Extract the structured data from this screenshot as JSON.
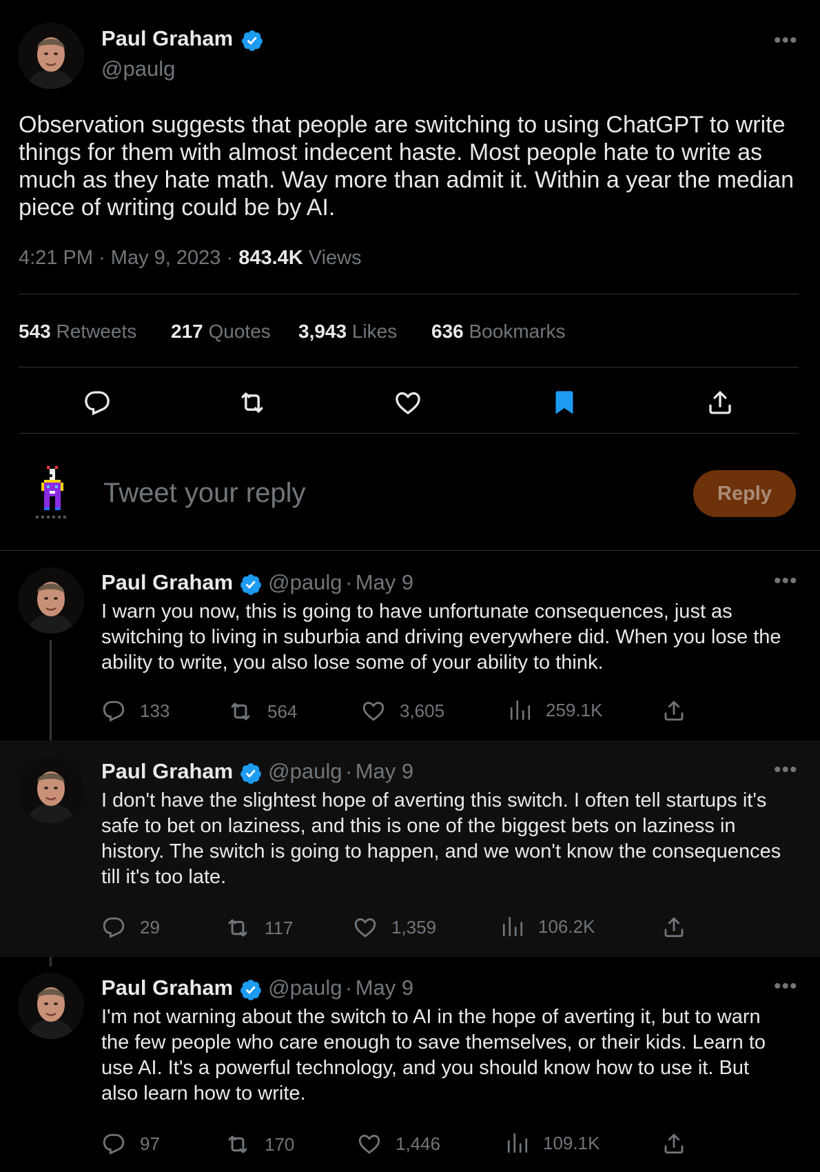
{
  "main_tweet": {
    "author_name": "Paul Graham",
    "author_handle": "@paulg",
    "text": "Observation suggests that people are switching to using ChatGPT to write things for them with almost indecent haste. Most people hate to write as much as they hate math. Way more than admit it. Within a year the median piece of writing could be by AI.",
    "time": "4:21 PM",
    "date": "May 9, 2023",
    "views_count": "843.4K",
    "views_label": "Views",
    "stats": [
      {
        "count": "543",
        "label": "Retweets"
      },
      {
        "count": "217",
        "label": "Quotes"
      },
      {
        "count": "3,943",
        "label": "Likes"
      },
      {
        "count": "636",
        "label": "Bookmarks"
      }
    ],
    "bookmarked": true
  },
  "reply_box": {
    "placeholder": "Tweet your reply",
    "button_label": "Reply"
  },
  "thread": [
    {
      "author_name": "Paul Graham",
      "author_handle": "@paulg",
      "date": "May 9",
      "text": "I warn you now, this is going to have unfortunate consequences, just as switching to living in suburbia and driving everywhere did. When you lose the ability to write, you also lose some of your ability to think.",
      "replies": "133",
      "retweets": "564",
      "likes": "3,605",
      "views": "259.1K"
    },
    {
      "author_name": "Paul Graham",
      "author_handle": "@paulg",
      "date": "May 9",
      "text": "I don't have the slightest hope of averting this switch. I often tell startups it's safe to bet on laziness, and this is one of the biggest bets on laziness in history. The switch is going to happen, and we won't know the consequences till it's too late.",
      "replies": "29",
      "retweets": "117",
      "likes": "1,359",
      "views": "106.2K"
    },
    {
      "author_name": "Paul Graham",
      "author_handle": "@paulg",
      "date": "May 9",
      "text": "I'm not warning about the switch to AI in the hope of averting it, but to warn the few people who care enough to save themselves, or their kids. Learn to use AI. It's a powerful technology, and you should know how to use it. But also learn how to write.",
      "replies": "97",
      "retweets": "170",
      "likes": "1,446",
      "views": "109.1K"
    }
  ],
  "colors": {
    "background": "#000000",
    "text": "#e7e9ea",
    "secondary": "#71767b",
    "divider": "#2f3336",
    "verified": "#1d9bf0",
    "bookmark_active": "#1d9bf0",
    "reply_button": "#6e320a",
    "highlight_row": "#0f0f0f"
  },
  "icons": {
    "verified": "verified-badge-icon",
    "more": "more-options-icon",
    "reply": "reply-icon",
    "retweet": "retweet-icon",
    "like": "heart-icon",
    "bookmark": "bookmark-icon",
    "share": "share-icon",
    "views": "views-icon"
  }
}
